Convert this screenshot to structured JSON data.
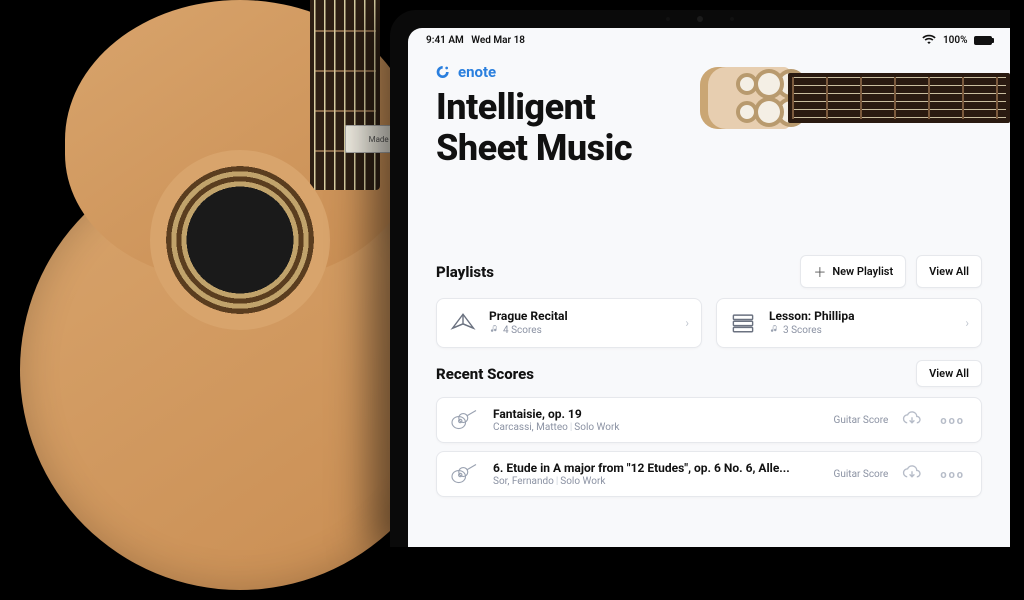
{
  "status_bar": {
    "time": "9:41 AM",
    "date": "Wed Mar 18",
    "battery": "100%"
  },
  "brand": {
    "name": "enote"
  },
  "hero": {
    "headline_l1": "Intelligent",
    "headline_l2": "Sheet Music"
  },
  "guitar_tag": "Made in Ger",
  "playlists": {
    "title": "Playlists",
    "new_label": "New Playlist",
    "view_all": "View All",
    "items": [
      {
        "title": "Prague Recital",
        "count": "4 Scores",
        "icon": "origami"
      },
      {
        "title": "Lesson: Phillipa",
        "count": "3 Scores",
        "icon": "books"
      }
    ]
  },
  "recent": {
    "title": "Recent Scores",
    "view_all": "View All",
    "items": [
      {
        "title": "Fantaisie, op. 19",
        "composer": "Carcassi, Matteo",
        "work": "Solo Work",
        "tag": "Guitar Score"
      },
      {
        "title": "6. Etude in A major from \"12 Etudes\", op. 6 No. 6, Alle...",
        "composer": "Sor, Fernando",
        "work": "Solo Work",
        "tag": "Guitar Score"
      }
    ]
  }
}
